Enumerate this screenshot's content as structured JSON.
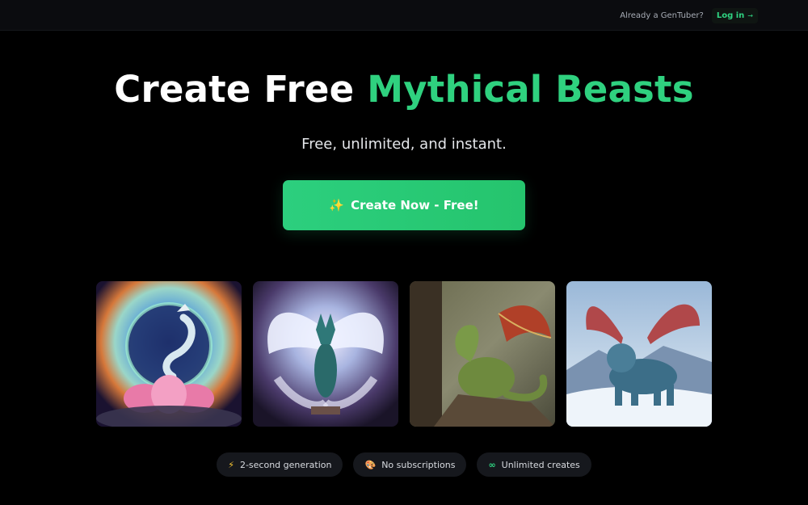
{
  "topbar": {
    "already_text": "Already a GenTuber?",
    "login_label": "Log in",
    "login_arrow": "→"
  },
  "hero": {
    "title_white": "Create Free ",
    "title_green": "Mythical Beasts",
    "subtitle": "Free, unlimited, and instant.",
    "cta_icon": "✨",
    "cta_label": "Create Now - Free!"
  },
  "gallery": {
    "images": [
      {
        "subject": "cosmic dragon on lotus"
      },
      {
        "subject": "winged fox spirit"
      },
      {
        "subject": "green dragon on rock"
      },
      {
        "subject": "winged lion in snow"
      }
    ]
  },
  "badges": [
    {
      "icon": "⚡",
      "label": "2-second generation"
    },
    {
      "icon": "🎨",
      "label": "No subscriptions"
    },
    {
      "icon": "∞",
      "label": "Unlimited creates"
    }
  ],
  "colors": {
    "accent": "#2fd17f",
    "background": "#000000",
    "topbar": "#0b0c0f",
    "badge_bg": "#16181d"
  }
}
